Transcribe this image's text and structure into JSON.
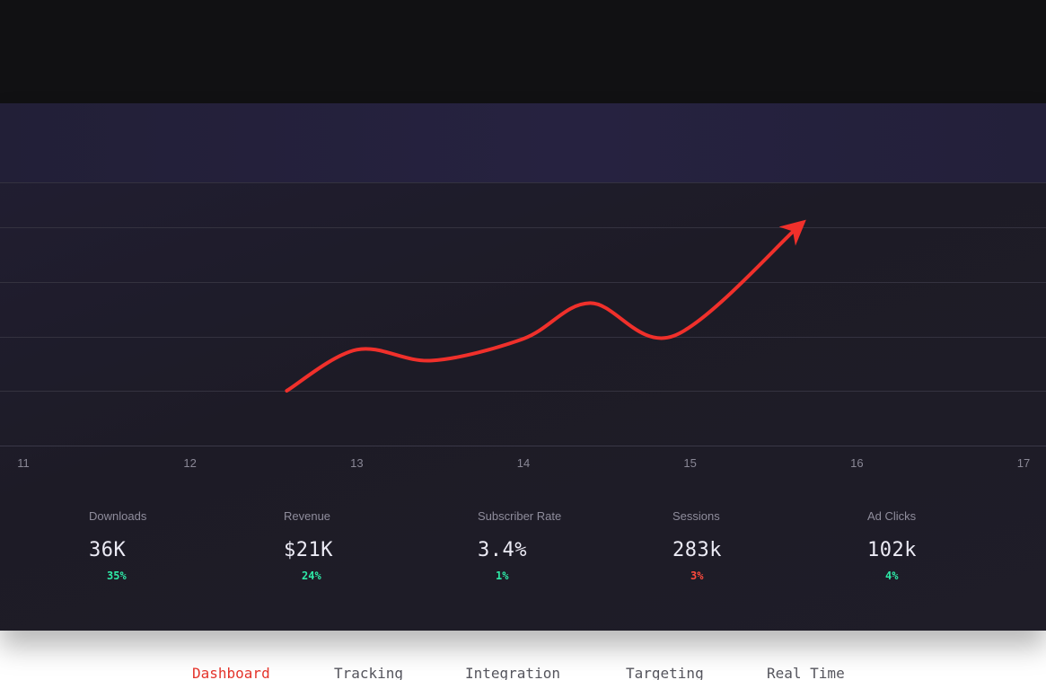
{
  "chart_data": {
    "type": "line",
    "x": [
      12.58,
      13,
      13.45,
      14,
      14.4,
      14.9,
      15.65
    ],
    "y": [
      2.0,
      3.5,
      3.1,
      3.9,
      5.2,
      4.0,
      8.0
    ],
    "x_ticks": [
      "11",
      "12",
      "13",
      "14",
      "15",
      "16",
      "17"
    ],
    "xlim": [
      11,
      17
    ],
    "ylim": [
      0,
      10
    ],
    "y_gridlines": 5,
    "grid": true,
    "arrowhead": true,
    "line_color": "#f0302b",
    "title": "",
    "xlabel": "",
    "ylabel": ""
  },
  "stats": [
    {
      "label": "Downloads",
      "value": "36K",
      "change": "35%",
      "trend": "up"
    },
    {
      "label": "Revenue",
      "value": "$21K",
      "change": "24%",
      "trend": "up"
    },
    {
      "label": "Subscriber Rate",
      "value": "3.4%",
      "change": "1%",
      "trend": "up"
    },
    {
      "label": "Sessions",
      "value": "283k",
      "change": "3%",
      "trend": "down"
    },
    {
      "label": "Ad Clicks",
      "value": "102k",
      "change": "4%",
      "trend": "up"
    }
  ],
  "nav": {
    "items": [
      "Dashboard",
      "Tracking",
      "Integration",
      "Targeting",
      "Real Time"
    ],
    "active": "Dashboard"
  },
  "colors": {
    "accent": "#e4342b",
    "positive": "#2ee8a6",
    "negative": "#ff4a3d",
    "panel": "#1e1c27"
  }
}
